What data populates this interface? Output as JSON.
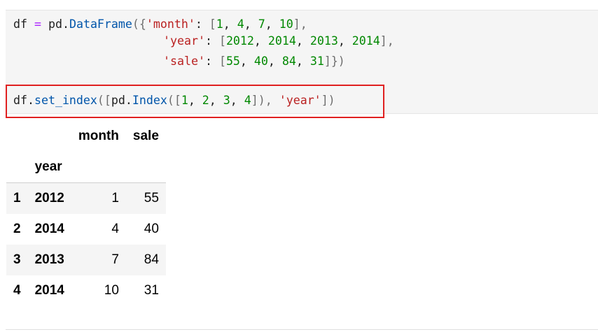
{
  "notebook": {
    "input_cell": {
      "lines": {
        "l1": {
          "var": "df",
          "eq": "=",
          "mod": "pd",
          "dot": ".",
          "fn": "DataFrame",
          "open": "({",
          "key": "'month'",
          "colon": ": ",
          "lb": "[",
          "v1": "1",
          "c1": ", ",
          "v2": "4",
          "c2": ", ",
          "v3": "7",
          "c3": ", ",
          "v4": "10",
          "rb": "],"
        },
        "l2": {
          "key": "'year'",
          "colon": ": ",
          "lb": "[",
          "v1": "2012",
          "c1": ", ",
          "v2": "2014",
          "c2": ", ",
          "v3": "2013",
          "c3": ", ",
          "v4": "2014",
          "rb": "],"
        },
        "l3": {
          "key": "'sale'",
          "colon": ": ",
          "lb": "[",
          "v1": "55",
          "c1": ", ",
          "v2": "40",
          "c2": ", ",
          "v3": "84",
          "c3": ", ",
          "v4": "31",
          "rb": "]})"
        },
        "l5": {
          "var": "df",
          "dot": ".",
          "fn": "set_index",
          "open": "([",
          "mod": "pd",
          "dot2": ".",
          "fn2": "Index",
          "open2": "([",
          "v1": "1",
          "c1": ", ",
          "v2": "2",
          "c2": ", ",
          "v3": "3",
          "c3": ", ",
          "v4": "4",
          "close2": "]), ",
          "str": "'year'",
          "close": "])"
        }
      }
    },
    "output_table": {
      "columns": [
        "month",
        "sale"
      ],
      "index_name": "year",
      "rows": [
        {
          "pos": "1",
          "year": "2012",
          "month": "1",
          "sale": "55"
        },
        {
          "pos": "2",
          "year": "2014",
          "month": "4",
          "sale": "40"
        },
        {
          "pos": "3",
          "year": "2013",
          "month": "7",
          "sale": "84"
        },
        {
          "pos": "4",
          "year": "2014",
          "month": "10",
          "sale": "31"
        }
      ]
    },
    "colors": {
      "highlight": "#e02020",
      "string": "#ba2121",
      "number": "#008800",
      "function": "#0055aa",
      "operator": "#aa22ff"
    }
  }
}
